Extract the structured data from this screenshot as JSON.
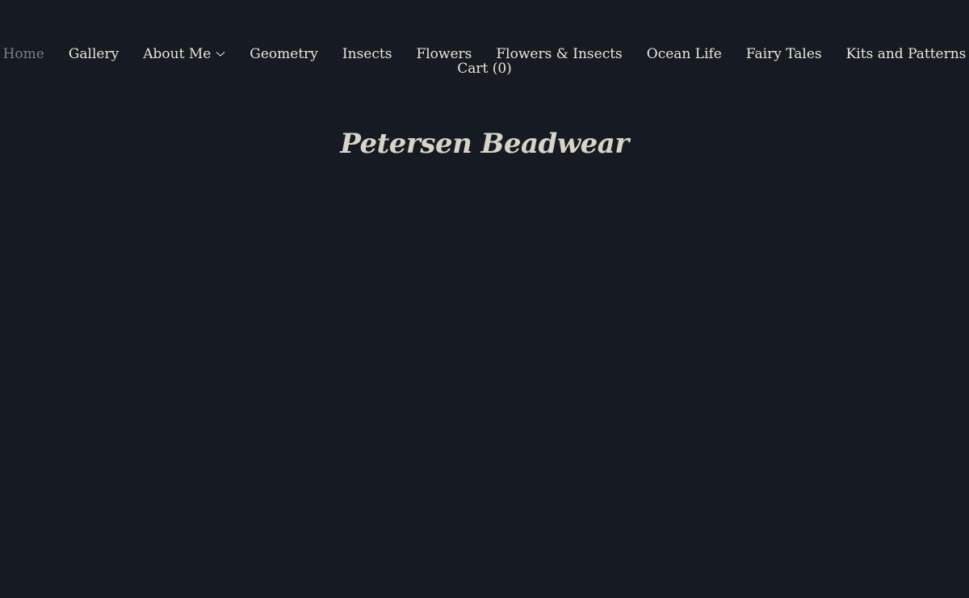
{
  "nav": {
    "items": [
      {
        "label": "Home",
        "active": true
      },
      {
        "label": "Gallery"
      },
      {
        "label": "About Me",
        "has_dropdown": true
      },
      {
        "label": "Geometry"
      },
      {
        "label": "Insects"
      },
      {
        "label": "Flowers"
      },
      {
        "label": "Flowers & Insects"
      },
      {
        "label": "Ocean Life"
      },
      {
        "label": "Fairy Tales"
      },
      {
        "label": "Kits and Patterns"
      }
    ],
    "cart_label": "Cart (0)"
  },
  "site": {
    "title": "Petersen Beadwear"
  },
  "colors": {
    "background": "#161a21",
    "text": "#e9e6df",
    "active_link": "#7b7e84",
    "title": "#d8d3c8"
  }
}
